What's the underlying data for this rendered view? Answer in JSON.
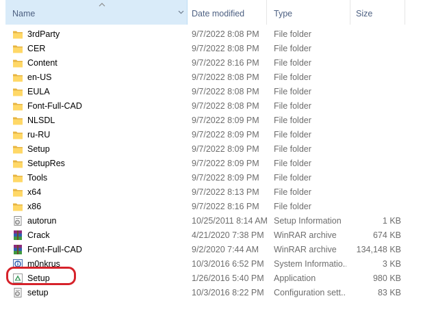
{
  "columns": {
    "name": "Name",
    "date_modified": "Date modified",
    "type": "Type",
    "size": "Size"
  },
  "files": [
    {
      "name": "3rdParty",
      "date": "9/7/2022 8:08 PM",
      "type": "File folder",
      "size": "",
      "icon": "folder-icon"
    },
    {
      "name": "CER",
      "date": "9/7/2022 8:08 PM",
      "type": "File folder",
      "size": "",
      "icon": "folder-icon"
    },
    {
      "name": "Content",
      "date": "9/7/2022 8:16 PM",
      "type": "File folder",
      "size": "",
      "icon": "folder-icon"
    },
    {
      "name": "en-US",
      "date": "9/7/2022 8:08 PM",
      "type": "File folder",
      "size": "",
      "icon": "folder-icon"
    },
    {
      "name": "EULA",
      "date": "9/7/2022 8:08 PM",
      "type": "File folder",
      "size": "",
      "icon": "folder-icon"
    },
    {
      "name": "Font-Full-CAD",
      "date": "9/7/2022 8:08 PM",
      "type": "File folder",
      "size": "",
      "icon": "folder-icon"
    },
    {
      "name": "NLSDL",
      "date": "9/7/2022 8:09 PM",
      "type": "File folder",
      "size": "",
      "icon": "folder-icon"
    },
    {
      "name": "ru-RU",
      "date": "9/7/2022 8:09 PM",
      "type": "File folder",
      "size": "",
      "icon": "folder-icon"
    },
    {
      "name": "Setup",
      "date": "9/7/2022 8:09 PM",
      "type": "File folder",
      "size": "",
      "icon": "folder-icon"
    },
    {
      "name": "SetupRes",
      "date": "9/7/2022 8:09 PM",
      "type": "File folder",
      "size": "",
      "icon": "folder-icon"
    },
    {
      "name": "Tools",
      "date": "9/7/2022 8:09 PM",
      "type": "File folder",
      "size": "",
      "icon": "folder-icon"
    },
    {
      "name": "x64",
      "date": "9/7/2022 8:13 PM",
      "type": "File folder",
      "size": "",
      "icon": "folder-icon"
    },
    {
      "name": "x86",
      "date": "9/7/2022 8:16 PM",
      "type": "File folder",
      "size": "",
      "icon": "folder-icon"
    },
    {
      "name": "autorun",
      "date": "10/25/2011 8:14 AM",
      "type": "Setup Information",
      "size": "1 KB",
      "icon": "setup-info-icon"
    },
    {
      "name": "Crack",
      "date": "4/21/2020 7:38 PM",
      "type": "WinRAR archive",
      "size": "674 KB",
      "icon": "winrar-archive-icon"
    },
    {
      "name": "Font-Full-CAD",
      "date": "9/2/2020 7:44 AM",
      "type": "WinRAR archive",
      "size": "134,148 KB",
      "icon": "winrar-archive-icon"
    },
    {
      "name": "m0nkrus",
      "date": "10/3/2016 6:52 PM",
      "type": "System Informatio...",
      "size": "3 KB",
      "icon": "system-info-icon"
    },
    {
      "name": "Setup",
      "date": "1/26/2016 5:40 PM",
      "type": "Application",
      "size": "980 KB",
      "icon": "application-icon"
    },
    {
      "name": "setup",
      "date": "10/3/2016 8:22 PM",
      "type": "Configuration sett...",
      "size": "83 KB",
      "icon": "config-settings-icon"
    }
  ],
  "annotation_color": "#d6222a"
}
